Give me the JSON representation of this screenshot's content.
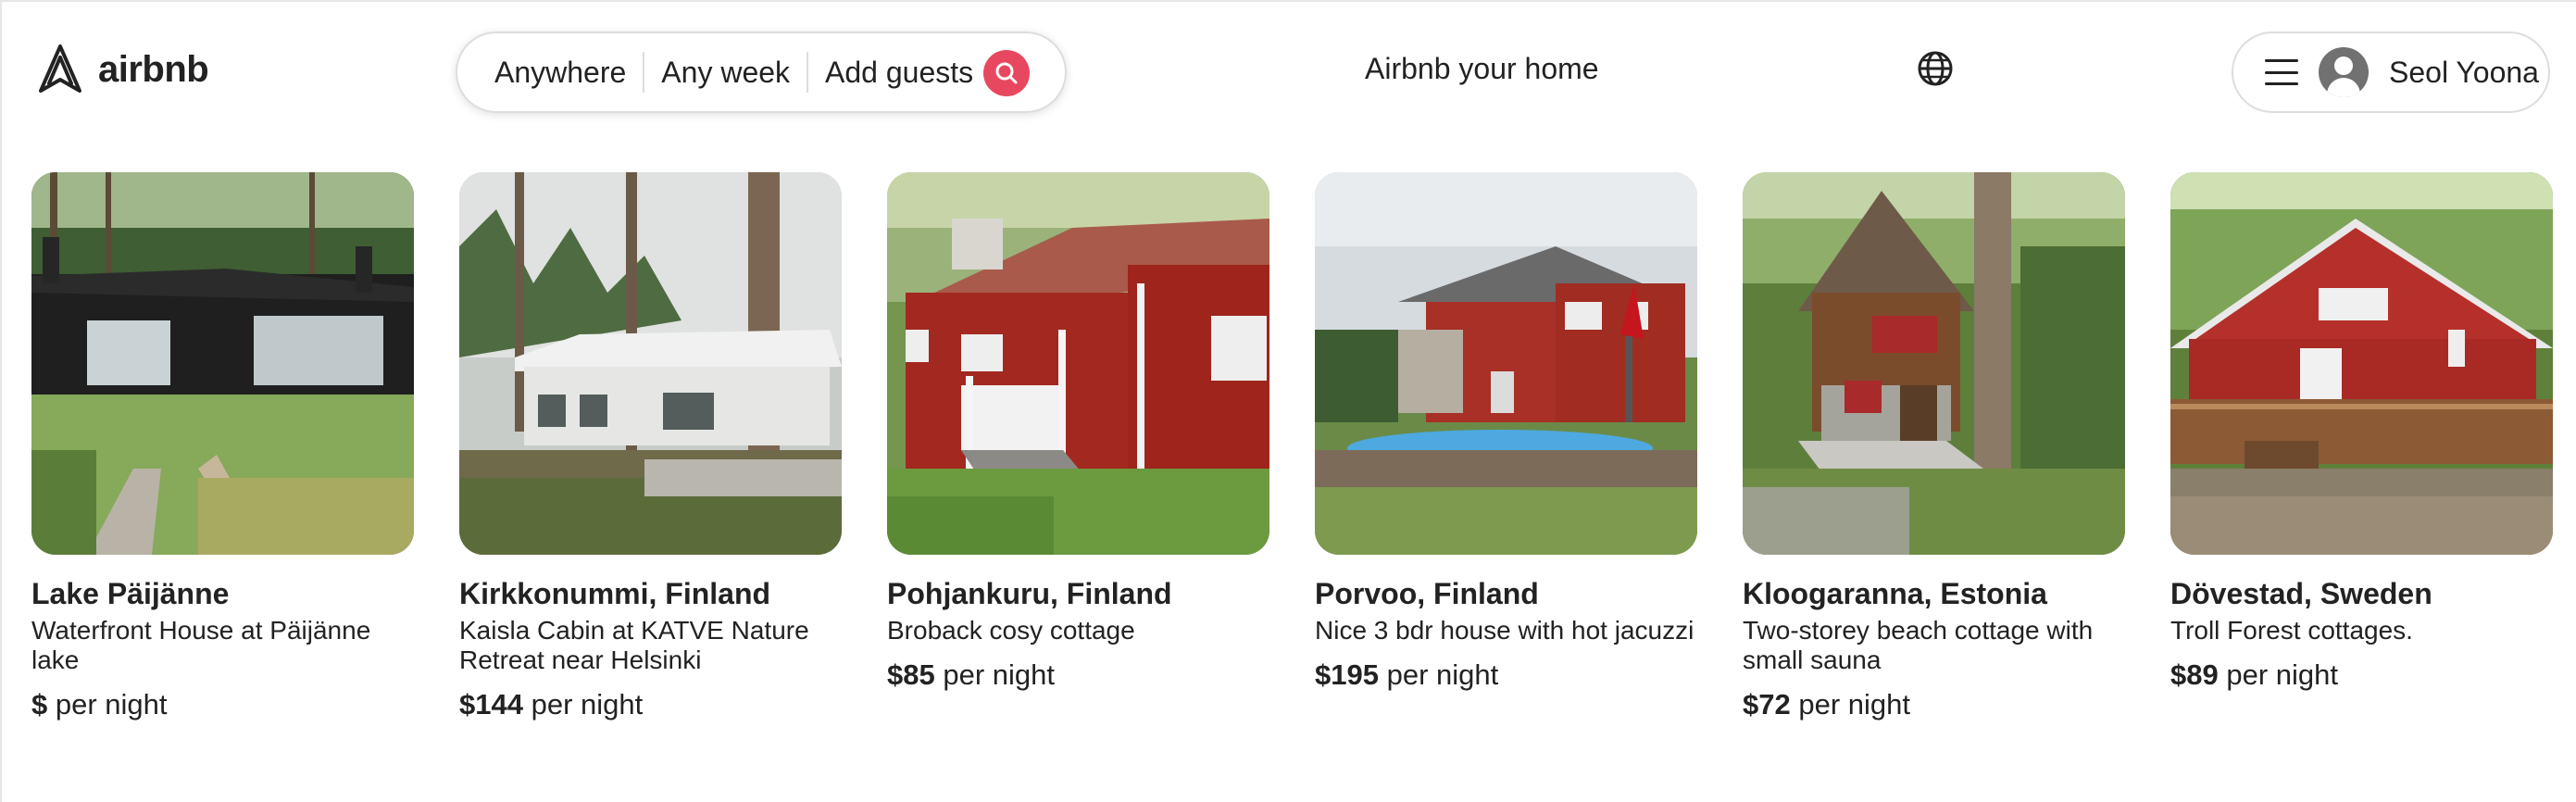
{
  "header": {
    "logo_text": "airbnb",
    "search": {
      "location": "Anywhere",
      "dates": "Any week",
      "guests": "Add guests"
    },
    "host_link": "Airbnb your home",
    "user_name": "Seol Yoona"
  },
  "icons": {
    "logo": "airbnb-logo-icon",
    "search": "search-icon",
    "language": "globe-icon",
    "menu": "hamburger-menu-icon",
    "avatar": "user-avatar-icon"
  },
  "colors": {
    "accent": "#e8485f",
    "text": "#222222",
    "border": "#dddddd"
  },
  "listings": [
    {
      "title": "Lake Päijänne",
      "description": "Waterfront House at Päijänne lake",
      "price": "$",
      "price_suffix": "per night"
    },
    {
      "title": "Kirkkonummi, Finland",
      "description": "Kaisla Cabin at KATVE Nature Retreat near Helsinki",
      "price": "$144",
      "price_suffix": "per night"
    },
    {
      "title": "Pohjankuru, Finland",
      "description": "Broback cosy cottage",
      "price": "$85",
      "price_suffix": "per night"
    },
    {
      "title": "Porvoo, Finland",
      "description": "Nice 3 bdr house with hot jacuzzi",
      "price": "$195",
      "price_suffix": "per night"
    },
    {
      "title": "Kloogaranna, Estonia",
      "description": "Two-storey beach cottage with small sauna",
      "price": "$72",
      "price_suffix": "per night"
    },
    {
      "title": "Dövestad, Sweden",
      "description": "Troll Forest cottages.",
      "price": "$89",
      "price_suffix": "per night"
    }
  ]
}
